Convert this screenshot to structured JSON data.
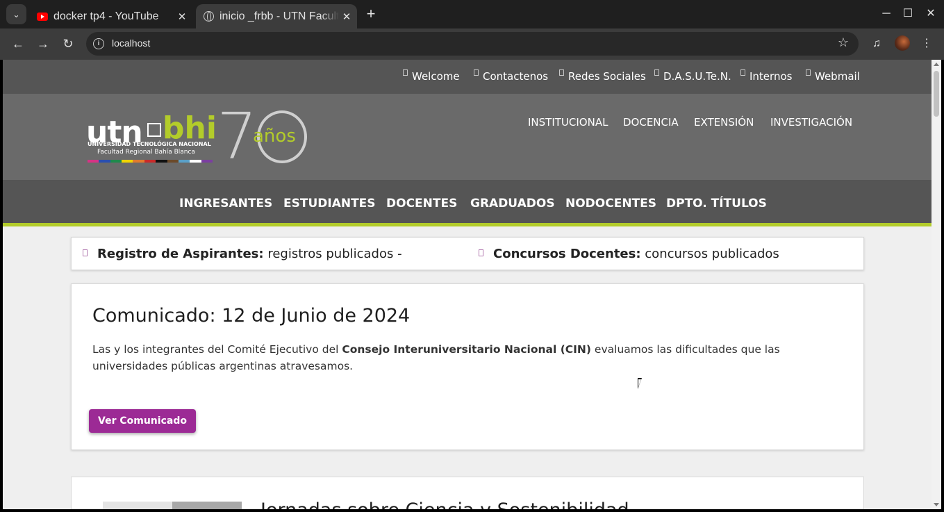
{
  "browser": {
    "tabs": [
      {
        "title": "docker tp4 - YouTube",
        "favicon": "youtube-icon",
        "active": false
      },
      {
        "title": "inicio _frbb - UTN Facultad Regional Bahía Blanca",
        "favicon": "globe-icon",
        "active": true
      }
    ],
    "address": "localhost",
    "colors": {
      "tabbar": "#1f1f1f",
      "toolbar": "#3c3c3c",
      "omnibox": "#282828"
    }
  },
  "site": {
    "top_links": [
      "Welcome",
      "Contactenos",
      "Redes Sociales",
      "D.A.S.U.Te.N.",
      "Internos",
      "Webmail"
    ],
    "logo": {
      "utn": "utn",
      "bhi": "bhi",
      "university": "UNIVERSIDAD TECNOLÓGICA NACIONAL",
      "faculty": "Facultad Regional Bahía Blanca",
      "anniversary_7": "7",
      "anniversary_years": "años"
    },
    "header_links": [
      "INSTITUCIONAL",
      "DOCENCIA",
      "EXTENSIÓN",
      "INVESTIGACIÓN"
    ],
    "main_nav": [
      "INGRESANTES",
      "ESTUDIANTES",
      "DOCENTES",
      "GRADUADOS",
      "NODOCENTES",
      "DPTO. TÍTULOS"
    ],
    "ticker": [
      {
        "label": "Registro de Aspirantes:",
        "text": "registros publicados -"
      },
      {
        "label": "Concursos Docentes:",
        "text": "concursos publicados"
      }
    ],
    "announcement": {
      "title": "Comunicado: 12 de Junio de 2024",
      "text_before": "Las y los integrantes del Comité Ejecutivo del ",
      "text_bold": "Consejo Interuniversitario Nacional (CIN)",
      "text_after": " evaluamos las dificultades que las universidades públicas argentinas atravesamos.",
      "button": "Ver Comunicado"
    },
    "next_card_title": "Jornadas sobre Ciencia y Sostenibilidad",
    "colors": {
      "accent_green": "#b3cc2a",
      "button_purple": "#9c2a95",
      "nav_bg": "#555555",
      "header_bg": "#6a6a6a"
    }
  }
}
